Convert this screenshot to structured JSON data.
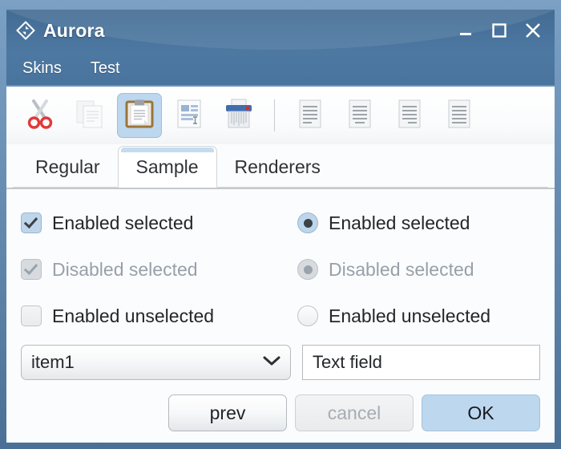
{
  "window": {
    "title": "Aurora",
    "icon": "aurora-diamond-icon",
    "controls": [
      {
        "name": "minimize-button",
        "glyph": "minimize-icon"
      },
      {
        "name": "maximize-button",
        "glyph": "maximize-icon"
      },
      {
        "name": "close-button",
        "glyph": "close-icon"
      }
    ],
    "frame_color": "#4a7096",
    "titlebar_color": "#47719a"
  },
  "menu": {
    "items": [
      {
        "label": "Skins"
      },
      {
        "label": "Test"
      }
    ]
  },
  "toolbar": {
    "items": [
      {
        "icon": "cut-scissors-icon",
        "label": "Cut",
        "selected": false
      },
      {
        "icon": "copy-pages-icon",
        "label": "Copy",
        "selected": false
      },
      {
        "icon": "paste-clipboard-icon",
        "label": "Paste",
        "selected": true
      },
      {
        "icon": "paste-special-document-icon",
        "label": "Paste Special",
        "selected": false
      },
      {
        "icon": "shredder-icon",
        "label": "Shred",
        "selected": false
      }
    ],
    "items2": [
      {
        "icon": "align-left-icon",
        "label": "Align Left"
      },
      {
        "icon": "align-center-icon",
        "label": "Align Center"
      },
      {
        "icon": "align-right-icon",
        "label": "Align Right"
      },
      {
        "icon": "align-justify-icon",
        "label": "Justify"
      }
    ],
    "selected_highlight": "#bcd7ee"
  },
  "tabs": [
    {
      "label": "Regular",
      "active": false
    },
    {
      "label": "Sample",
      "active": true
    },
    {
      "label": "Renderers",
      "active": false
    }
  ],
  "options": {
    "checkboxes": [
      {
        "label": "Enabled selected",
        "checked": true,
        "disabled": false
      },
      {
        "label": "Disabled selected",
        "checked": true,
        "disabled": true
      },
      {
        "label": "Enabled unselected",
        "checked": false,
        "disabled": false
      }
    ],
    "radios": [
      {
        "label": "Enabled selected",
        "checked": true,
        "disabled": false
      },
      {
        "label": "Disabled selected",
        "checked": true,
        "disabled": true
      },
      {
        "label": "Enabled unselected",
        "checked": false,
        "disabled": false
      }
    ]
  },
  "fields": {
    "combo": {
      "value": "item1",
      "chevron": "chevron-down-icon"
    },
    "text": {
      "value": "Text field"
    }
  },
  "buttons": [
    {
      "label": "prev",
      "state": "normal"
    },
    {
      "label": "cancel",
      "state": "disabled"
    },
    {
      "label": "OK",
      "state": "default"
    }
  ]
}
